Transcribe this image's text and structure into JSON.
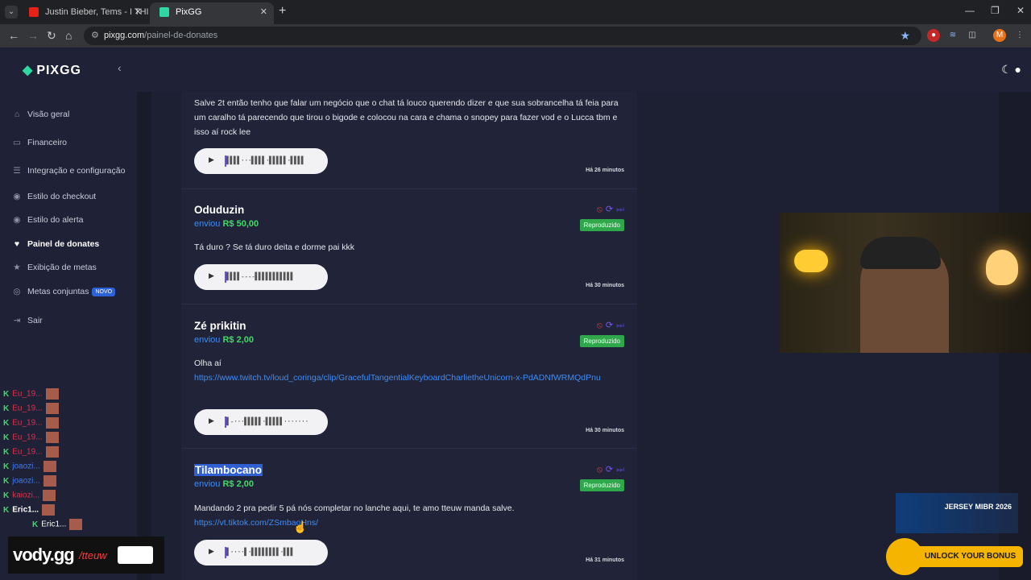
{
  "browser": {
    "tabs": [
      {
        "title": "Justin Bieber, Tems - I THINK Y..."
      },
      {
        "title": "PixGG"
      }
    ],
    "url_host": "pixgg.com",
    "url_path": "/painel-de-donates",
    "profile_initial": "M"
  },
  "sidebar": {
    "brand": "PIXGG",
    "items": [
      {
        "label": "Visão geral"
      },
      {
        "label": "Financeiro"
      },
      {
        "label": "Integração e configuração"
      },
      {
        "label": "Estilo do checkout"
      },
      {
        "label": "Estilo do alerta"
      },
      {
        "label": "Painel de donates"
      },
      {
        "label": "Exibição de metas"
      },
      {
        "label": "Metas conjuntas"
      },
      {
        "label": "Sair"
      }
    ],
    "new_badge": "NOVO"
  },
  "donations": [
    {
      "message": "Salve 2t então tenho que falar um negócio que o chat tá louco querendo dizer e que sua sobrancelha tá feia para um caralho tá parecendo que tirou o bigode e colocou na cara e chama o snopey para fazer vod e o Lucca tbm e isso aí rock lee",
      "time": "Há 26 minutos"
    },
    {
      "name": "Oduduzin",
      "sent_label": "enviou",
      "amount": "R$ 50,00",
      "status": "Reproduzido",
      "message": "Tá duro ? Se tá duro deita e dorme pai kkk",
      "time": "Há 30 minutos"
    },
    {
      "name": "Zé prikitin",
      "sent_label": "enviou",
      "amount": "R$ 2,00",
      "status": "Reproduzido",
      "message": "Olha aí",
      "link": "https://www.twitch.tv/loud_coringa/clip/GracefulTangentialKeyboardCharlietheUnicorn-x-PdADNfWRMQdPnu",
      "time": "Há 30 minutos"
    },
    {
      "name": "Tilambocano",
      "sent_label": "enviou",
      "amount": "R$ 2,00",
      "status": "Reproduzido",
      "message": "Mandando 2 pra pedir 5 pá nós completar no lanche aqui, te amo tteuw manda salve.",
      "link": "https://vt.tiktok.com/ZSmbaoHns/",
      "time": "Há 31 minutos"
    }
  ],
  "player": {
    "waves": [
      "▌▌▌▌···▌▌▌▌·▌▌▌▌▌·▌▌▌▌",
      "▌▌▌▌----▌▌▌▌▌▌▌▌▌▌▌",
      "▌-···▌▌▌▌▌·▌▌▌▌▌·······",
      "▌····▌·▌▌▌▌▌▌▌▌·▌▌▌"
    ]
  },
  "chat": [
    {
      "user": "Eu_19...",
      "color": "#e0304a"
    },
    {
      "user": "Eu_19...",
      "color": "#e0304a"
    },
    {
      "user": "Eu_19...",
      "color": "#e0304a"
    },
    {
      "user": "Eu_19...",
      "color": "#e0304a"
    },
    {
      "user": "Eu_19...",
      "color": "#e0304a"
    },
    {
      "user": "joaozi...",
      "color": "#3e7cf5"
    },
    {
      "user": "joaozi...",
      "color": "#3e7cf5"
    },
    {
      "user": "kaiozi...",
      "color": "#e0304a"
    },
    {
      "user": "Eric1...",
      "color": "#ffffff"
    },
    {
      "user": "Eric1...",
      "color": "#ffffff"
    }
  ],
  "overlays": {
    "vody_brand": "vody.gg",
    "vody_handle": "/tteuw",
    "promo_text": "JERSEY MIBR 2026",
    "unlock_text": "UNLOCK YOUR BONUS"
  }
}
